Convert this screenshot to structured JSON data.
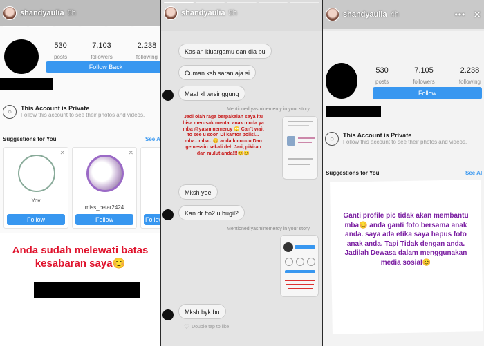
{
  "stories": [
    {
      "username": "shandyaulia",
      "time": "5h",
      "profile": {
        "posts": "530",
        "posts_label": "posts",
        "followers": "7.103",
        "followers_label": "followers",
        "following": "2.238",
        "following_label": "following",
        "button": "Follow Back"
      },
      "private_title": "This Account is Private",
      "private_sub": "Follow this account to see their photos and videos.",
      "suggestions_title": "Suggestions for You",
      "see_all": "See A",
      "cards": [
        {
          "name": "Yov",
          "follow": "Follow"
        },
        {
          "name": "miss_cetar2424",
          "follow": "Follow"
        },
        {
          "name": "",
          "follow": "Follow"
        }
      ],
      "caption": "Anda sudah melewati batas kesabaran saya😊"
    },
    {
      "username": "shandyaulia",
      "time": "5h",
      "messages": [
        "Kasian kluargamu dan dia bu",
        "Cuman ksh saran aja si",
        "Maaf kl tersinggung"
      ],
      "mention_1": "Mentioned yasminemercy in your story",
      "story_text_1": "Jadi olah raga berpakaian saya itu bisa merusak mental anak muda ya mba @yasminemercy 🙄 Can't wait to see u soon Di kantor polisi... mba...mba...😊 anda lucuuuu Dan gemessin sekali deh Jari, pikiran dan mulut anda!!!😊😊",
      "messages_2": [
        "Mksh yee",
        "Kan dr fto2 u bugil2"
      ],
      "mention_2": "Mentioned yasminemercy in your story",
      "message_3": "Mksh byk bu",
      "double_tap": "Double tap to like"
    },
    {
      "username": "shandyaulia",
      "time": "4h",
      "profile": {
        "posts": "530",
        "posts_label": "posts",
        "followers": "7.105",
        "followers_label": "followers",
        "following": "2.238",
        "following_label": "following",
        "button": "Follow"
      },
      "private_title": "This Account is Private",
      "private_sub": "Follow this account to see their photos and videos.",
      "suggestions_title": "Suggestions for You",
      "see_all": "See Al",
      "caption": "Ganti profile pic tidak akan membantu mba😊 anda ganti foto bersama anak anda. saya ada etika saya hapus foto anak anda. Tapi Tidak dengan anda. Jadilah Dewasa dalam menggunakan media sosial😊"
    }
  ],
  "colors": {
    "blue": "#3897f0",
    "red_caption": "#e0142e",
    "purple_caption": "#7b1fa2"
  },
  "icons": [
    "more-icon",
    "close-icon",
    "lock-icon",
    "heart-icon"
  ]
}
